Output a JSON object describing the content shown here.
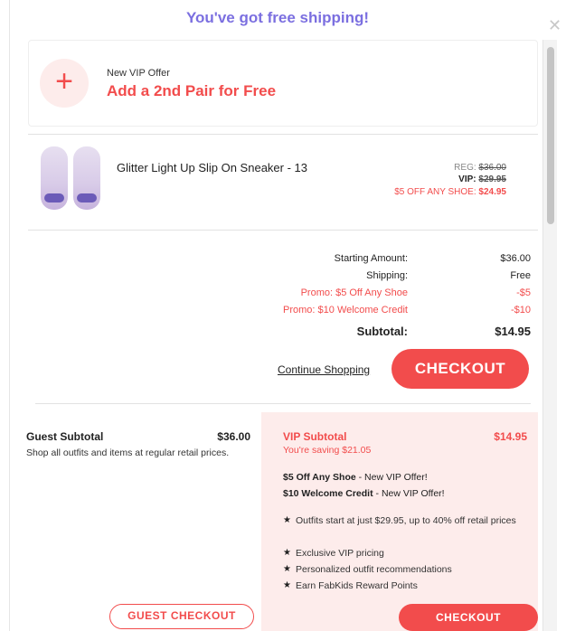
{
  "banner": {
    "text": "You've got free shipping!"
  },
  "offer": {
    "small_label": "New VIP Offer",
    "title": "Add a 2nd Pair for Free",
    "plus_symbol": "+"
  },
  "product": {
    "name": "Glitter Light Up Slip On Sneaker - 13",
    "reg_label": "REG:",
    "reg_price": "$36.00",
    "vip_label": "VIP:",
    "vip_price": "$29.95",
    "promo_label": "$5 OFF ANY SHOE:",
    "promo_price": "$24.95"
  },
  "summary": {
    "rows": [
      {
        "label": "Starting Amount:",
        "value": "$36.00"
      },
      {
        "label": "Shipping:",
        "value": "Free"
      },
      {
        "label": "Promo: $5 Off Any Shoe",
        "value": "-$5"
      },
      {
        "label": "Promo: $10 Welcome Credit",
        "value": "-$10"
      }
    ],
    "subtotal_label": "Subtotal:",
    "subtotal_value": "$14.95",
    "continue_label": "Continue Shopping",
    "checkout_label": "CHECKOUT"
  },
  "guest": {
    "title": "Guest Subtotal",
    "price": "$36.00",
    "description": "Shop all outfits and items at regular retail prices.",
    "button_label": "GUEST CHECKOUT"
  },
  "vip": {
    "title": "VIP Subtotal",
    "price": "$14.95",
    "saving": "You're saving $21.05",
    "offers": [
      {
        "bold": "$5 Off Any Shoe",
        "rest": " - New VIP Offer!"
      },
      {
        "bold": "$10 Welcome Credit",
        "rest": " - New VIP Offer!"
      }
    ],
    "benefits": [
      "Outfits start at just $29.95, up to 40% off retail prices",
      "Exclusive VIP pricing",
      "Personalized outfit recommendations",
      "Earn FabKids Reward Points"
    ],
    "button_label": "CHECKOUT"
  },
  "colors": {
    "accent": "#f24c4c",
    "banner": "#7b6fe0",
    "vip_bg": "#fdeceb"
  }
}
